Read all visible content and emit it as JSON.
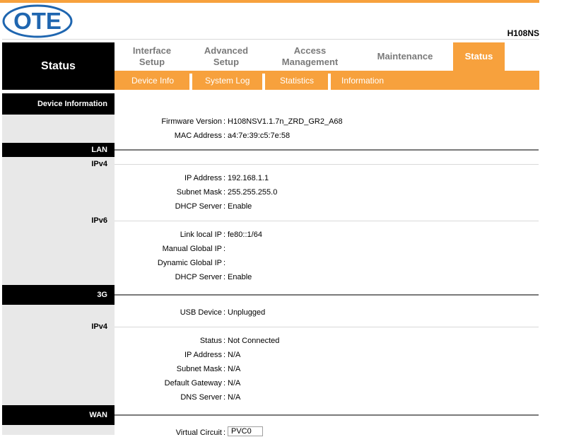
{
  "brand": {
    "logo_text": "OTE",
    "model": "H108NS",
    "accent": "#f7a13d"
  },
  "nav": {
    "current": "Status",
    "tabs": [
      {
        "line1": "Interface",
        "line2": "Setup"
      },
      {
        "line1": "Advanced",
        "line2": "Setup"
      },
      {
        "line1": "Access",
        "line2": "Management"
      },
      {
        "line1": "Maintenance",
        "line2": ""
      },
      {
        "line1": "Status",
        "line2": ""
      }
    ],
    "subtabs": [
      "Device Info",
      "System Log",
      "Statistics",
      "Information"
    ]
  },
  "device_info": {
    "title": "Device Information",
    "rows": [
      {
        "label": "Firmware Version",
        "value": "H108NSV1.1.7n_ZRD_GR2_A68"
      },
      {
        "label": "MAC Address",
        "value": "a4:7e:39:c5:7e:58"
      }
    ]
  },
  "lan": {
    "title": "LAN",
    "ipv4_title": "IPv4",
    "ipv4_rows": [
      {
        "label": "IP Address",
        "value": "192.168.1.1"
      },
      {
        "label": "Subnet Mask",
        "value": "255.255.255.0"
      },
      {
        "label": "DHCP Server",
        "value": "Enable"
      }
    ],
    "ipv6_title": "IPv6",
    "ipv6_rows": [
      {
        "label": "Link local IP",
        "value": "fe80::1/64"
      },
      {
        "label": "Manual Global IP",
        "value": ""
      },
      {
        "label": "Dynamic Global IP",
        "value": ""
      },
      {
        "label": "DHCP Server",
        "value": "Enable"
      }
    ]
  },
  "g3": {
    "title": "3G",
    "usb_label": "USB Device",
    "usb_value": "Unplugged",
    "ipv4_title": "IPv4",
    "ipv4_rows": [
      {
        "label": "Status",
        "value": "Not Connected"
      },
      {
        "label": "IP Address",
        "value": "N/A"
      },
      {
        "label": "Subnet Mask",
        "value": "N/A"
      },
      {
        "label": "Default Gateway",
        "value": "N/A"
      },
      {
        "label": "DNS Server",
        "value": "N/A"
      }
    ]
  },
  "wan": {
    "title": "WAN",
    "vc_label": "Virtual Circuit",
    "vc_value": "PVC0"
  },
  "colon": ":"
}
